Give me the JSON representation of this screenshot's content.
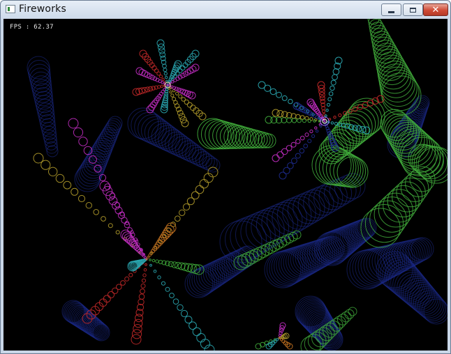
{
  "window": {
    "title": "Fireworks",
    "buttons": {
      "minimize": "",
      "maximize": "",
      "close": "✕"
    }
  },
  "hud": {
    "fps": "FPS : 62.37"
  },
  "colors": {
    "background": "#000000",
    "blue_trail": "#1c2a8a",
    "green": "#3fa83a",
    "magenta": "#c02cc0",
    "red": "#c02828",
    "cyan": "#2aa6b0",
    "yellow": "#b09a2a",
    "orange": "#c07020"
  }
}
